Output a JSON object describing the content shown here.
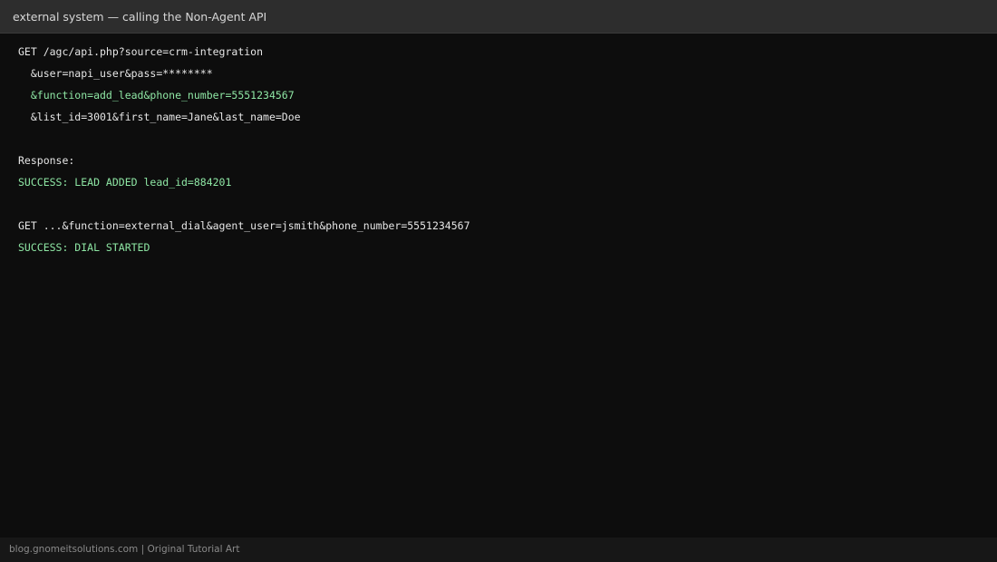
{
  "window": {
    "title": "external system — calling the Non-Agent API"
  },
  "terminal": {
    "lines": [
      {
        "text": "GET /agc/api.php?source=crm-integration",
        "color": "#e6e6e6"
      },
      {
        "text": "  &user=napi_user&pass=********",
        "color": "#e6e6e6"
      },
      {
        "text": "  &function=add_lead&phone_number=5551234567",
        "color": "#8ee6a4"
      },
      {
        "text": "  &list_id=3001&first_name=Jane&last_name=Doe",
        "color": "#e6e6e6"
      },
      {
        "text": "Response:",
        "color": "#e6e6e6"
      },
      {
        "text": "SUCCESS: LEAD ADDED lead_id=884201",
        "color": "#8ee6a4"
      },
      {
        "text": "GET ...&function=external_dial&agent_user=jsmith&phone_number=5551234567",
        "color": "#e6e6e6"
      },
      {
        "text": "SUCCESS: DIAL STARTED",
        "color": "#8ee6a4"
      }
    ]
  },
  "footer": {
    "text": "blog.gnomeitsolutions.com | Original Tutorial Art"
  }
}
